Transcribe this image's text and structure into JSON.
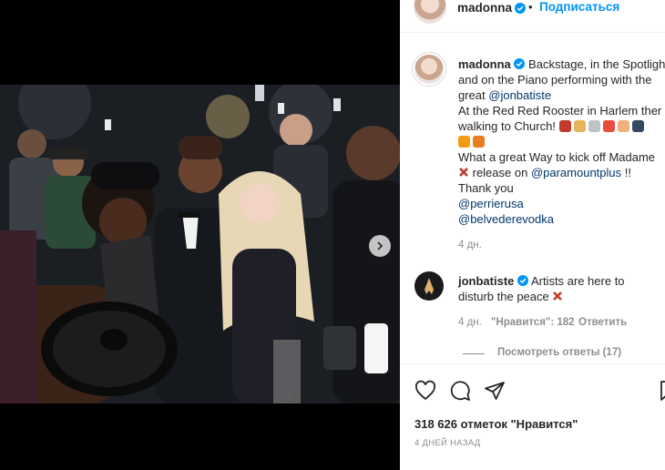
{
  "post_owner": {
    "username": "madonna",
    "follow_label": "Подписаться",
    "separator": "•"
  },
  "caption": {
    "username": "madonna",
    "line1": "Backstage, in the Spotligh",
    "line2": "and on the Piano performing with the",
    "line3_prefix": "great ",
    "line3_link": "@jonbatiste",
    "line4": "At the Red Red Rooster in Harlem ther",
    "line5": "walking to Church!",
    "line7": "What a great Way to kick off Madame",
    "line8_text": " release on ",
    "line8_link": "@paramountplus",
    "line8_end": " !!",
    "line9": "Thank you",
    "link_perrier": "@perrierusa",
    "link_belvedere": "@belvederevodka",
    "age": "4 дн."
  },
  "comment": {
    "username": "jonbatiste",
    "line1": "Artists are here to",
    "line2": "disturb the peace",
    "age": "4 дн.",
    "likes": "\"Нравится\": 182",
    "reply_label": "Ответить",
    "view_replies": "Посмотреть ответы (17)"
  },
  "icons": {
    "next": "chevron-right-icon",
    "like": "heart-icon",
    "comment": "comment-icon",
    "share": "paper-plane-icon",
    "save": "bookmark-icon",
    "verified": "verified-badge-icon"
  },
  "likes_text": "318 626 отметок \"Нравится\"",
  "date_text": "4 ДНЕЙ НАЗАД",
  "colors": {
    "link": "#00376b",
    "follow": "#0095f6",
    "verified": "#0095f6",
    "muted": "#8e8e8e",
    "text": "#262626"
  }
}
